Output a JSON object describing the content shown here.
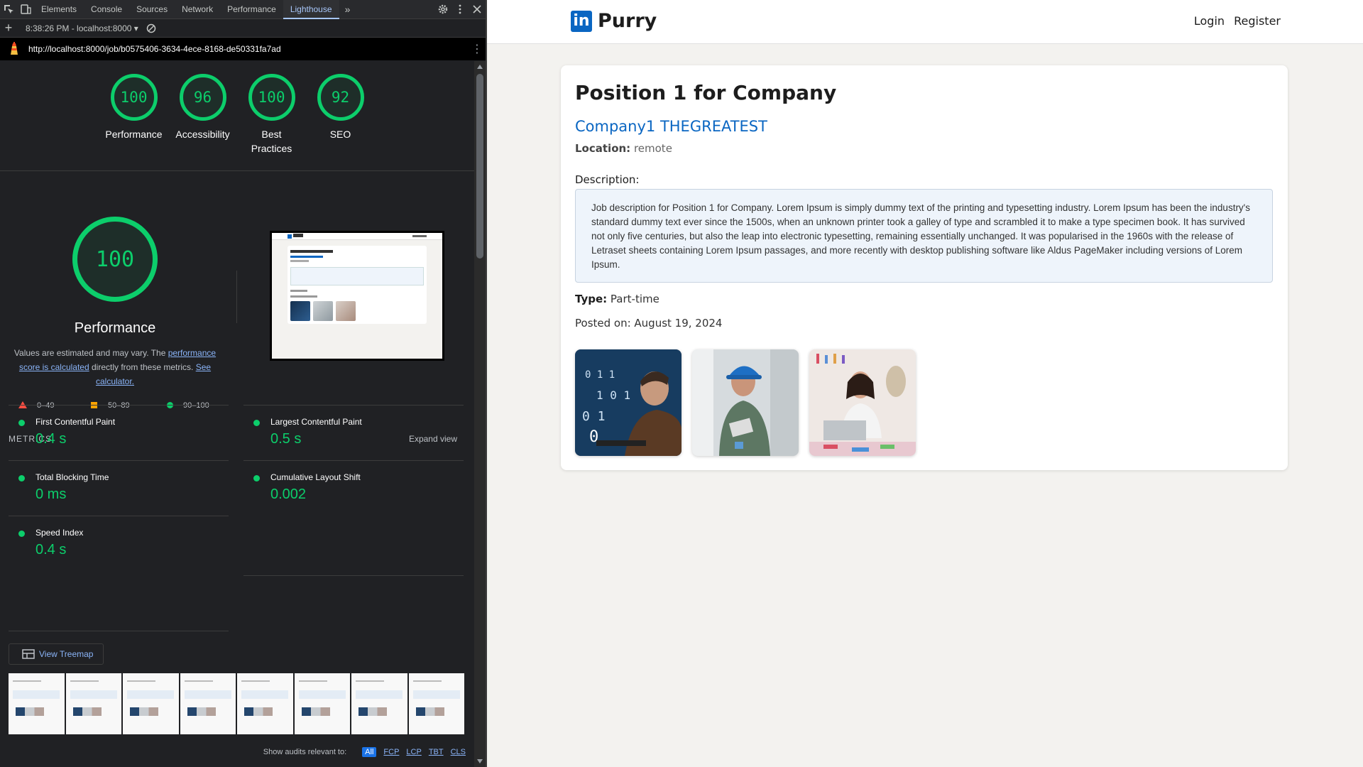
{
  "devtools": {
    "tabs": [
      "Elements",
      "Console",
      "Sources",
      "Network",
      "Performance",
      "Lighthouse"
    ],
    "active_tab": "Lighthouse",
    "report_selector": "8:38:26 PM - localhost:8000 ▾",
    "url": "http://localhost:8000/job/b0575406-3634-4ece-8168-de50331fa7ad",
    "scores": [
      {
        "value": "100",
        "label": "Performance"
      },
      {
        "value": "96",
        "label": "Accessibility"
      },
      {
        "value": "100",
        "label": "Best Practices"
      },
      {
        "value": "92",
        "label": "SEO"
      }
    ],
    "performance": {
      "score": "100",
      "title": "Performance",
      "desc_prefix": "Values are estimated and may vary. The ",
      "desc_link1": "performance score is calculated",
      "desc_mid": " directly from these metrics. ",
      "desc_link2": "See calculator.",
      "legend": {
        "fail": "0–49",
        "average": "50–89",
        "pass": "90–100"
      }
    },
    "metrics_title": "METRICS",
    "expand_view": "Expand view",
    "metrics": [
      {
        "name": "First Contentful Paint",
        "value": "0.4 s"
      },
      {
        "name": "Largest Contentful Paint",
        "value": "0.5 s"
      },
      {
        "name": "Total Blocking Time",
        "value": "0 ms"
      },
      {
        "name": "Cumulative Layout Shift",
        "value": "0.002"
      },
      {
        "name": "Speed Index",
        "value": "0.4 s"
      }
    ],
    "treemap_button": "View Treemap",
    "audits_label": "Show audits relevant to:",
    "audit_filters": [
      "All",
      "FCP",
      "LCP",
      "TBT",
      "CLS"
    ],
    "colors": {
      "pass": "#0cce6b",
      "average": "#ffa400",
      "fail": "#ff4e42",
      "link": "#8ab4f8"
    }
  },
  "site": {
    "brand": "Purry",
    "logo_text": "in",
    "login": "Login",
    "register": "Register",
    "job": {
      "title": "Position 1 for Company",
      "company": "Company1 THEGREATEST",
      "location_label": "Location:",
      "location": "remote",
      "description_label": "Description:",
      "description": "Job description for Position 1 for Company. Lorem Ipsum is simply dummy text of the printing and typesetting industry. Lorem Ipsum has been the industry's standard dummy text ever since the 1500s, when an unknown printer took a galley of type and scrambled it to make a type specimen book. It has survived not only five centuries, but also the leap into electronic typesetting, remaining essentially unchanged. It was popularised in the 1960s with the release of Letraset sheets containing Lorem Ipsum passages, and more recently with desktop publishing software like Aldus PageMaker including versions of Lorem Ipsum.",
      "type_label": "Type:",
      "type": "Part-time",
      "posted": "Posted on: August 19, 2024"
    },
    "colors": {
      "brand": "#0a66c2",
      "background": "#f3f2ef"
    }
  }
}
